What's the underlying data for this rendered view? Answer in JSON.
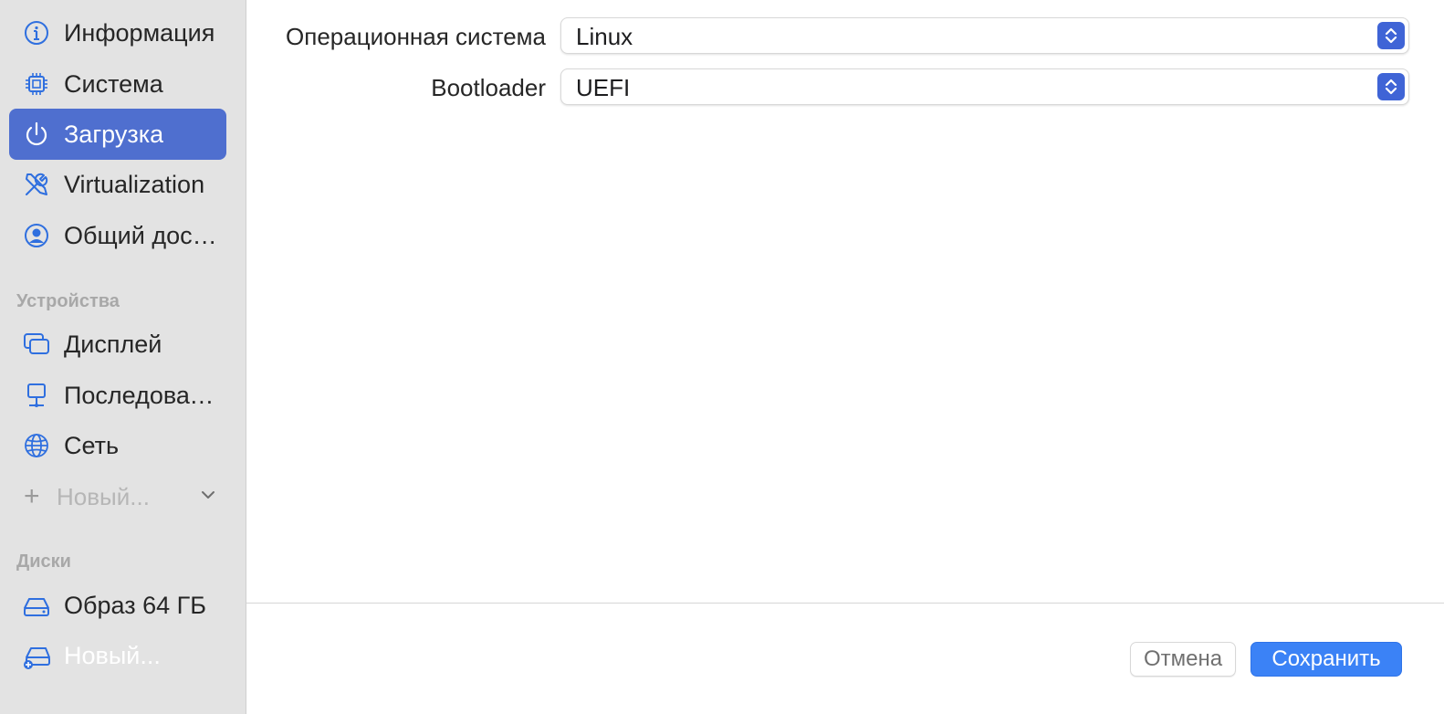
{
  "sidebar": {
    "items": [
      {
        "label": "Информация",
        "icon": "info-icon"
      },
      {
        "label": "Система",
        "icon": "cpu-icon"
      },
      {
        "label": "Загрузка",
        "icon": "power-icon",
        "selected": true
      },
      {
        "label": "Virtualization",
        "icon": "wrench-screwdriver-icon"
      },
      {
        "label": "Общий доступ",
        "icon": "person-circle-icon"
      }
    ],
    "devices_header": "Устройства",
    "devices": [
      {
        "label": "Дисплей",
        "icon": "display-icon"
      },
      {
        "label": "Последовательный порт",
        "icon": "serial-icon"
      },
      {
        "label": "Сеть",
        "icon": "globe-icon"
      }
    ],
    "new_device_label": "Новый...",
    "disks_header": "Диски",
    "disks": [
      {
        "label": "Образ 64 ГБ",
        "icon": "drive-icon"
      },
      {
        "label": "Новый...",
        "icon": "drive-add-icon"
      }
    ]
  },
  "form": {
    "os_label": "Операционная система",
    "os_value": "Linux",
    "bootloader_label": "Bootloader",
    "bootloader_value": "UEFI"
  },
  "footer": {
    "cancel_label": "Отмена",
    "save_label": "Сохранить"
  },
  "colors": {
    "accent": "#3f64d6",
    "selected_bg": "#4f6fcf",
    "save_bg": "#3b82f6",
    "sidebar_bg": "#e3e3e3"
  }
}
